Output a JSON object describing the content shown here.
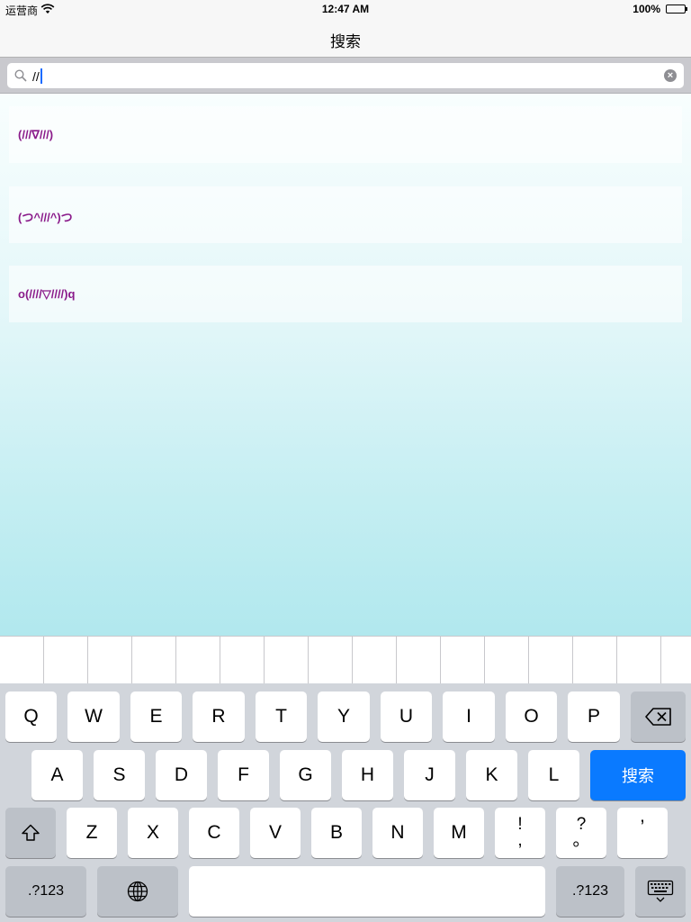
{
  "status_bar": {
    "carrier": "运营商",
    "time": "12:47 AM",
    "battery": "100%"
  },
  "nav": {
    "title": "搜索"
  },
  "search": {
    "query": "//"
  },
  "results": [
    "(///∇///)",
    "(つ^///^)つ",
    "o(////▽////)q"
  ],
  "keyboard": {
    "row1": [
      "Q",
      "W",
      "E",
      "R",
      "T",
      "Y",
      "U",
      "I",
      "O",
      "P"
    ],
    "row2": [
      "A",
      "S",
      "D",
      "F",
      "G",
      "H",
      "J",
      "K",
      "L"
    ],
    "search_key": "搜索",
    "row3": [
      "Z",
      "X",
      "C",
      "V",
      "B",
      "N",
      "M"
    ],
    "exclaim_top": "!",
    "exclaim_bottom": ",",
    "question_top": "?",
    "question_bottom": "。",
    "apostrophe": "’",
    "num_left": ".?123",
    "num_right": ".?123"
  },
  "colors": {
    "accent": "#0a7aff",
    "result_text": "#8a1a8a"
  }
}
